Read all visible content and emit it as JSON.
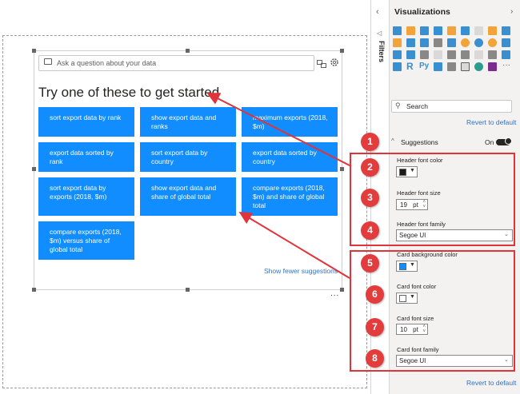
{
  "qa": {
    "placeholder": "Ask a question about your data"
  },
  "header": "Try one of these to get started",
  "cards": [
    "sort export data by rank",
    "show export data and ranks",
    "maximum exports (2018, $m)",
    "export data sorted by rank",
    "sort export data by country",
    "export data sorted by country",
    "sort export data by exports (2018, $m)",
    "show export data and share of global total",
    "compare exports (2018, $m) and share of global total",
    "compare exports (2018, $m) versus share of global total"
  ],
  "show_fewer": "Show fewer suggestions",
  "more_dots": "...",
  "filters_label": "Filters",
  "pane": {
    "title": "Visualizations",
    "search_label": "Search",
    "revert": "Revert to default",
    "suggestions_label": "Suggestions",
    "toggle_label": "On",
    "header_font_color_label": "Header font color",
    "header_font_color": "#1b1a19",
    "header_font_size_label": "Header font size",
    "header_font_size": "19",
    "header_font_family_label": "Header font family",
    "header_font_family": "Segoe UI",
    "card_bg_color_label": "Card background color",
    "card_bg_color": "#118dff",
    "card_font_color_label": "Card font color",
    "card_font_color": "#ffffff",
    "card_font_size_label": "Card font size",
    "card_font_size": "10",
    "card_font_family_label": "Card font family",
    "card_font_family": "Segoe UI",
    "unit": "pt"
  },
  "badges": [
    "1",
    "2",
    "3",
    "4",
    "5",
    "6",
    "7",
    "8"
  ],
  "colors": {
    "card": "#118dff",
    "badge": "#e23c3c",
    "annotation": "#e0333a"
  }
}
